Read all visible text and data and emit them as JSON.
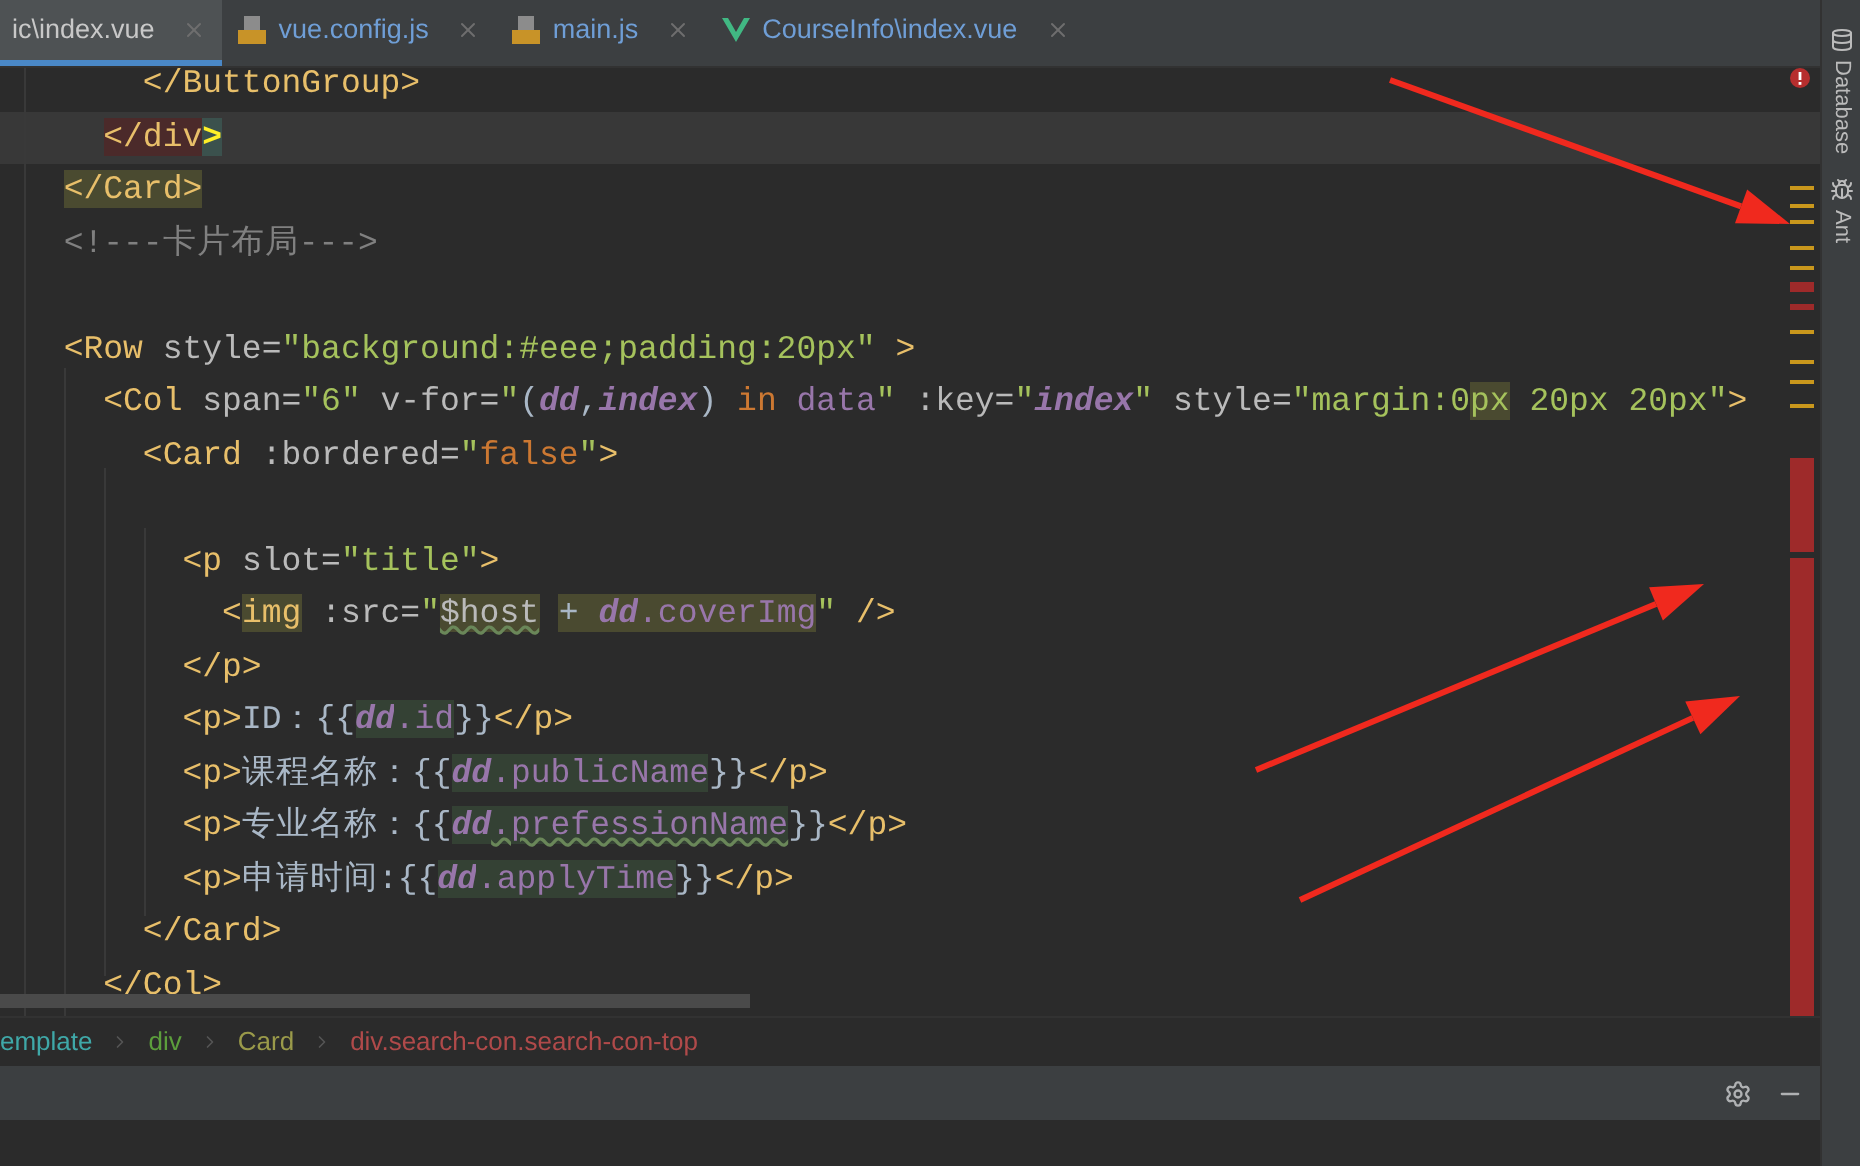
{
  "tabs": [
    {
      "label": "ic\\index.vue",
      "selected": true
    },
    {
      "label": "vue.config.js",
      "kind": "js",
      "selected": false
    },
    {
      "label": "main.js",
      "kind": "js",
      "selected": false
    },
    {
      "label": "CourseInfo\\index.vue",
      "kind": "vue",
      "selected": false
    }
  ],
  "code_lines": [
    {
      "current": false,
      "tokens": [
        {
          "kind": "tag",
          "text": "      </ButtonGroup>"
        }
      ]
    },
    {
      "current": true,
      "tokens": [
        {
          "kind": "tag",
          "text": "    </div",
          "match": true
        },
        {
          "kind": "brace",
          "text": ">",
          "match": true
        }
      ]
    },
    {
      "current": false,
      "tokens": [
        {
          "kind": "tag",
          "text": "  </Card>",
          "usage": true
        }
      ]
    },
    {
      "current": false,
      "tokens": [
        {
          "kind": "comment",
          "text": "  <!---卡片布局--->"
        }
      ]
    },
    {
      "current": false
    },
    {
      "current": false,
      "tokens": [
        {
          "kind": "tag",
          "text": "  <Row"
        },
        {
          "kind": "attr",
          "text": " style="
        },
        {
          "kind": "string",
          "text": "\"background:#eee;padding:20px\""
        },
        {
          "kind": "tag",
          "text": " >"
        }
      ]
    },
    {
      "current": false,
      "tokens": [
        {
          "kind": "tag",
          "text": "    <Col"
        },
        {
          "kind": "attr",
          "text": " span="
        },
        {
          "kind": "string",
          "text": "\"6\""
        },
        {
          "kind": "attr",
          "text": " v-for="
        },
        {
          "kind": "string",
          "text": "\""
        },
        {
          "kind": "text",
          "text": "("
        },
        {
          "kind": "var",
          "text": "dd"
        },
        {
          "kind": "text",
          "text": ","
        },
        {
          "kind": "var",
          "text": "index"
        },
        {
          "kind": "text",
          "text": ")"
        },
        {
          "kind": "keyword",
          "text": " in"
        },
        {
          "kind": "field",
          "text": " data"
        },
        {
          "kind": "string",
          "text": "\""
        },
        {
          "kind": "attr",
          "text": " :key="
        },
        {
          "kind": "string",
          "text": "\""
        },
        {
          "kind": "var",
          "text": "index"
        },
        {
          "kind": "string",
          "text": "\""
        },
        {
          "kind": "attr",
          "text": " style="
        },
        {
          "kind": "string",
          "text": "\"margin:0"
        },
        {
          "kind": "string",
          "text": "px",
          "usage": true
        },
        {
          "kind": "string",
          "text": " 20px 20px\""
        },
        {
          "kind": "tag",
          "text": ">"
        }
      ]
    },
    {
      "current": false,
      "tokens": [
        {
          "kind": "tag",
          "text": "      <Card"
        },
        {
          "kind": "attr",
          "text": " :bordered="
        },
        {
          "kind": "string",
          "text": "\""
        },
        {
          "kind": "keyword",
          "text": "false"
        },
        {
          "kind": "string",
          "text": "\""
        },
        {
          "kind": "tag",
          "text": ">"
        }
      ]
    },
    {
      "current": false
    },
    {
      "current": false,
      "tokens": [
        {
          "kind": "tag",
          "text": "        <p"
        },
        {
          "kind": "attr",
          "text": " slot="
        },
        {
          "kind": "string",
          "text": "\"title\""
        },
        {
          "kind": "tag",
          "text": ">"
        }
      ]
    },
    {
      "current": false,
      "tokens": [
        {
          "kind": "tag",
          "text": "          <"
        },
        {
          "kind": "tag",
          "text": "img",
          "usage": true
        },
        {
          "kind": "attr",
          "text": " :src="
        },
        {
          "kind": "string",
          "text": "\""
        },
        {
          "kind": "attr",
          "text": "$host",
          "usage": true,
          "typo": true
        },
        {
          "kind": "text",
          "text": " + ",
          "usage": true
        },
        {
          "kind": "var",
          "text": "dd",
          "usage": true
        },
        {
          "kind": "field",
          "text": ".coverImg",
          "usage": true
        },
        {
          "kind": "string",
          "text": "\""
        },
        {
          "kind": "tag",
          "text": " />"
        }
      ]
    },
    {
      "current": false,
      "tokens": [
        {
          "kind": "tag",
          "text": "        </p>"
        }
      ]
    },
    {
      "current": false,
      "tokens": [
        {
          "kind": "tag",
          "text": "        <p>"
        },
        {
          "kind": "text",
          "text": "ID：{{"
        },
        {
          "kind": "var",
          "text": "dd",
          "read": true
        },
        {
          "kind": "field",
          "text": ".id",
          "read": true
        },
        {
          "kind": "text",
          "text": "}}"
        },
        {
          "kind": "tag",
          "text": "</p>"
        }
      ]
    },
    {
      "current": false,
      "tokens": [
        {
          "kind": "tag",
          "text": "        <p>"
        },
        {
          "kind": "text",
          "text": "课程名称：{{"
        },
        {
          "kind": "var",
          "text": "dd",
          "read": true
        },
        {
          "kind": "field",
          "text": ".publicName",
          "read": true
        },
        {
          "kind": "text",
          "text": "}}"
        },
        {
          "kind": "tag",
          "text": "</p>"
        }
      ]
    },
    {
      "current": false,
      "tokens": [
        {
          "kind": "tag",
          "text": "        <p>"
        },
        {
          "kind": "text",
          "text": "专业名称：{{"
        },
        {
          "kind": "var",
          "text": "dd",
          "read": true
        },
        {
          "kind": "field",
          "text": ".prefessionName",
          "read": true,
          "typo": true
        },
        {
          "kind": "text",
          "text": "}}"
        },
        {
          "kind": "tag",
          "text": "</p>"
        }
      ]
    },
    {
      "current": false,
      "tokens": [
        {
          "kind": "tag",
          "text": "        <p>"
        },
        {
          "kind": "text",
          "text": "申请时间:{{"
        },
        {
          "kind": "var",
          "text": "dd",
          "read": true
        },
        {
          "kind": "field",
          "text": ".applyTime",
          "read": true
        },
        {
          "kind": "text",
          "text": "}}"
        },
        {
          "kind": "tag",
          "text": "</p>"
        }
      ]
    },
    {
      "current": false,
      "tokens": [
        {
          "kind": "tag",
          "text": "      </Card>"
        }
      ]
    },
    {
      "current": false,
      "tokens": [
        {
          "kind": "tag",
          "text": "    </Col>"
        }
      ]
    }
  ],
  "breadcrumbs": [
    {
      "label": "emplate",
      "color": "#3fa8a8"
    },
    {
      "label": "div",
      "color": "#5c9e3c"
    },
    {
      "label": "Card",
      "color": "#9a9a4a"
    },
    {
      "label": "div.search-con.search-con-top",
      "color": "#b04a4a"
    }
  ],
  "right_toolbar": [
    {
      "label": "Database",
      "kind": "database"
    },
    {
      "label": "Ant",
      "kind": "ant"
    }
  ]
}
